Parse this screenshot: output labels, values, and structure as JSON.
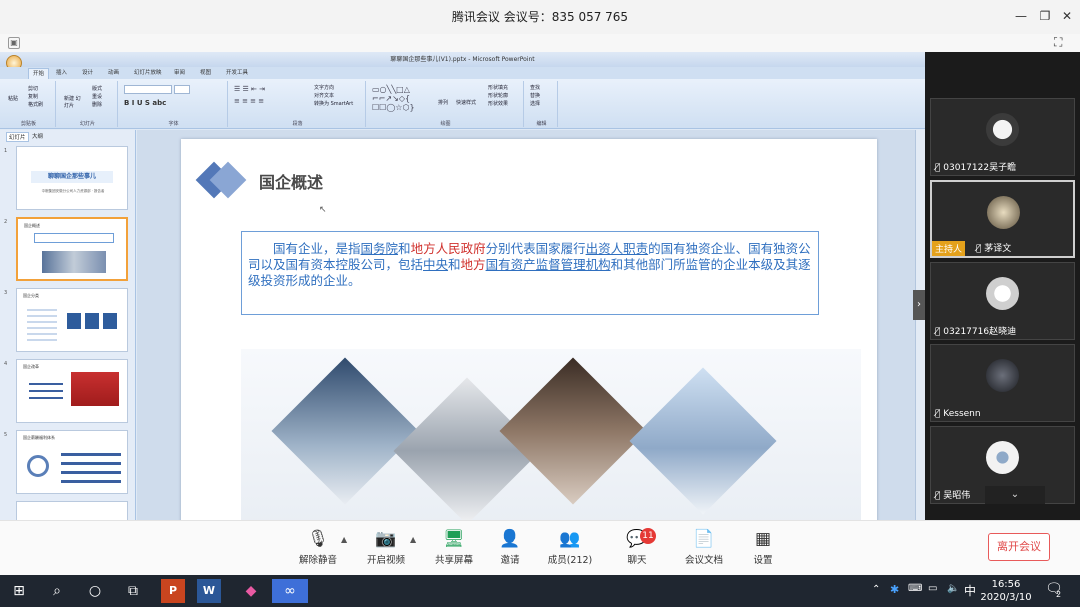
{
  "meeting": {
    "title": "腾讯会议 会议号：835 057 765"
  },
  "ppt": {
    "window_title": "聊聊国企那些事儿(V1).pptx - Microsoft PowerPoint",
    "tabs": [
      "开始",
      "插入",
      "设计",
      "动画",
      "幻灯片放映",
      "审阅",
      "视图",
      "开发工具"
    ],
    "ribbon_groups": [
      "剪贴板",
      "幻灯片",
      "字体",
      "段落",
      "绘图",
      "编辑"
    ],
    "ribbon_buttons": {
      "paste": "粘贴",
      "cut": "剪切",
      "copy": "复制",
      "format_painter": "格式刷",
      "new_slide": "新建\n幻灯片",
      "layout": "版式",
      "reset": "重设",
      "delete": "删除",
      "text_direction": "文字方向",
      "align_text": "对齐文本",
      "smartart": "转换为 SmartArt",
      "arrange": "排列",
      "quick_styles": "快速样式",
      "shape_fill": "形状填充",
      "shape_outline": "形状轮廓",
      "shape_effects": "形状效果",
      "find": "查找",
      "replace": "替换",
      "select": "选择"
    },
    "pane_tabs": [
      "幻灯片",
      "大纲"
    ],
    "thumbnails": [
      {
        "num": "1",
        "title": "聊聊国企那些事儿",
        "subtitle": "中粮集团安徽分公司人力资源部 · 报告者"
      },
      {
        "num": "2",
        "title": "国企概述"
      },
      {
        "num": "3",
        "title": "国企分类"
      },
      {
        "num": "4",
        "title": "国企改革"
      },
      {
        "num": "5",
        "title": "国企薪酬福利体系"
      }
    ],
    "slide": {
      "title": "国企概述",
      "body_segments": [
        {
          "text": "国有企业，是指",
          "style": "normal"
        },
        {
          "text": "国务院",
          "style": "underline"
        },
        {
          "text": "和",
          "style": "normal"
        },
        {
          "text": "地方人民政府",
          "style": "red"
        },
        {
          "text": "分别代表国家履行",
          "style": "normal"
        },
        {
          "text": "出资人职责",
          "style": "underline"
        },
        {
          "text": "的国有独资企业、国有独资公司以及国有资本控股公司，包括",
          "style": "normal"
        },
        {
          "text": "中央",
          "style": "underline"
        },
        {
          "text": "和",
          "style": "normal"
        },
        {
          "text": "地方",
          "style": "red"
        },
        {
          "text": "国有资产监督管理机构",
          "style": "underline"
        },
        {
          "text": "和其他部门所监管的企业本级及其逐级投资形成的企业。",
          "style": "normal"
        }
      ]
    }
  },
  "participants": [
    {
      "name": "03017122吴子瞻",
      "host": false
    },
    {
      "name": "茅译文",
      "host": true,
      "host_label": "主持人"
    },
    {
      "name": "03217716赵晓迪",
      "host": false
    },
    {
      "name": "Kessenn",
      "host": false
    },
    {
      "name": "吴昭伟",
      "host": false
    }
  ],
  "controls": {
    "mute": "解除静音",
    "video": "开启视频",
    "share": "共享屏幕",
    "invite": "邀请",
    "members": "成员(212)",
    "chat": "聊天",
    "chat_unread": "11",
    "docs": "会议文档",
    "settings": "设置",
    "leave": "离开会议"
  },
  "taskbar": {
    "time": "16:56",
    "date": "2020/3/10",
    "ime": "中",
    "notifications": "2"
  },
  "colors": {
    "accent_blue": "#2f6fbf",
    "accent_red": "#d0312d",
    "host_badge": "#e4a11b",
    "leave_red": "#e04848"
  }
}
